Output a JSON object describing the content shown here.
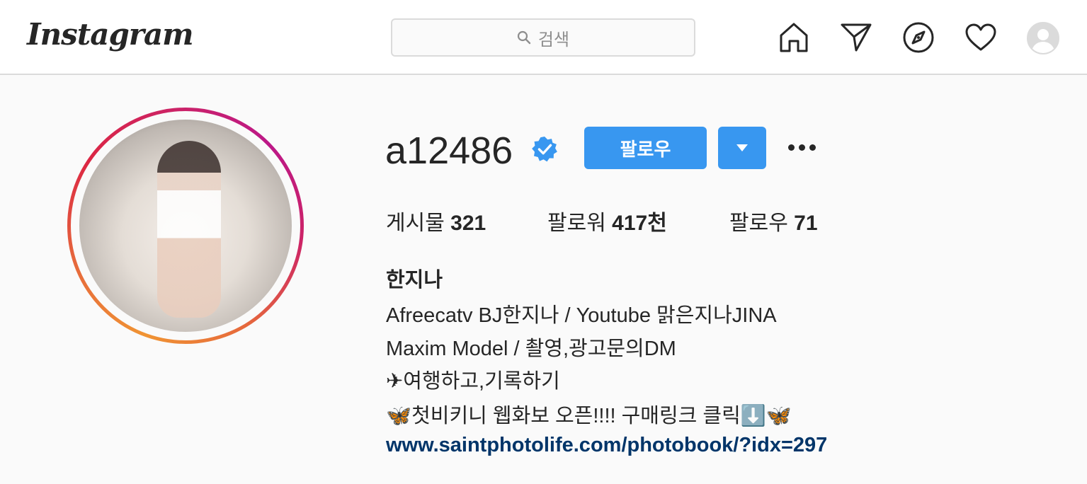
{
  "header": {
    "logo": "Instagram",
    "search_placeholder": "검색",
    "icons": [
      "home-icon",
      "direct-icon",
      "explore-icon",
      "activity-icon",
      "profile-icon"
    ]
  },
  "profile": {
    "username": "a12486",
    "verified": true,
    "follow_label": "팔로우",
    "stats": {
      "posts_label": "게시물",
      "posts_value": "321",
      "followers_label": "팔로워",
      "followers_value": "417천",
      "following_label": "팔로우",
      "following_value": "71"
    },
    "bio": {
      "name": "한지나",
      "line1": "Afreecatv BJ한지나 / Youtube 맑은지나JINA",
      "line2": "Maxim Model / 촬영,광고문의DM",
      "line3": "✈여행하고,기록하기",
      "line4": "🦋첫비키니 웹화보 오픈!!!! 구매링크 클릭⬇️🦋",
      "link": "www.saintphotolife.com/photobook/?idx=297"
    }
  },
  "colors": {
    "accent": "#3897f0",
    "verified": "#3897f0",
    "link": "#003569"
  }
}
